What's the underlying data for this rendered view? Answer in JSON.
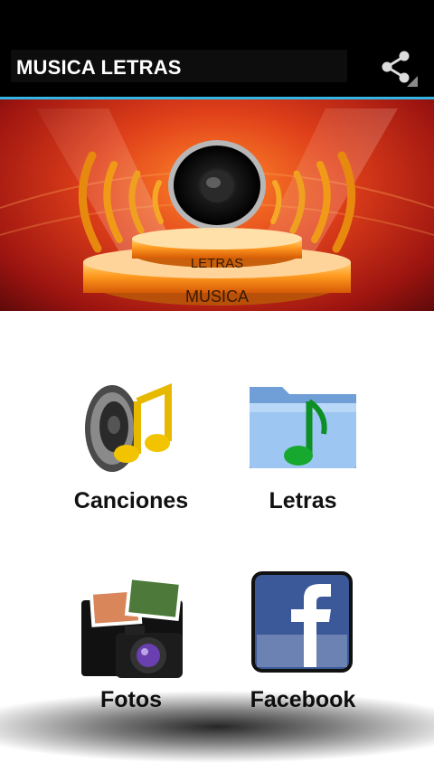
{
  "app": {
    "title": "MUSICA LETRAS"
  },
  "header": {
    "share_icon": "share-icon"
  },
  "banner": {
    "stage_top_text": "LETRAS",
    "stage_bottom_text": "MUSICA",
    "speaker_icon": "speaker-icon"
  },
  "menu": {
    "items": [
      {
        "label": "Canciones",
        "icon": "music-speaker-icon"
      },
      {
        "label": "Letras",
        "icon": "music-folder-icon"
      },
      {
        "label": "Fotos",
        "icon": "photo-camera-folder-icon"
      },
      {
        "label": "Facebook",
        "icon": "facebook-icon"
      }
    ]
  },
  "colors": {
    "accent": "#33b5e5",
    "action_bar": "#000000",
    "banner_red": "#c8261a",
    "banner_orange": "#ff8a2a",
    "facebook_blue": "#3b5998"
  }
}
